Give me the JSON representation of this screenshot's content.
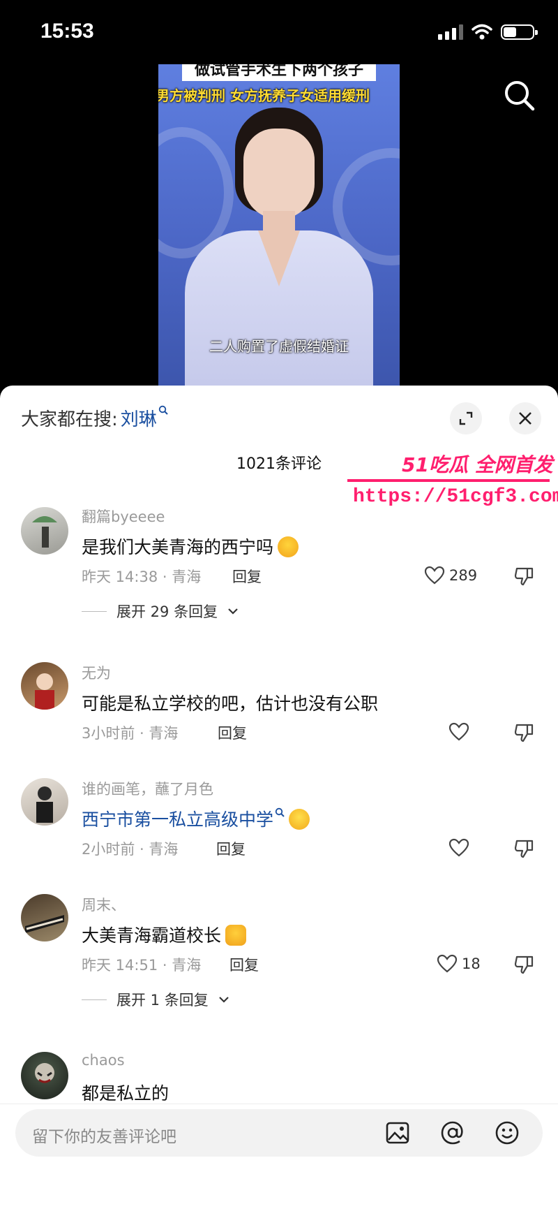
{
  "status_bar": {
    "time": "15:53"
  },
  "video": {
    "banner_top": "做试管手术生下两个孩子",
    "banner_second": "男方被判刑 女方抚养子女适用缓刑",
    "subtitle": "二人购置了虚假结婚证"
  },
  "panel": {
    "trending_label": "大家都在搜:",
    "trending_keyword": "刘琳",
    "comment_count": "1021条评论"
  },
  "watermark": {
    "brand": "51吃瓜 全网首发",
    "url": "https://51cgf3.com"
  },
  "comments": [
    {
      "name": "翻篇byeeee",
      "text": "是我们大美青海的西宁吗",
      "emoji": "laughing-with-tears",
      "meta": "昨天 14:38 · 青海",
      "reply": "回复",
      "likes": "289",
      "expand": "展开 29 条回复"
    },
    {
      "name": "无为",
      "text": "可能是私立学校的吧，估计也没有公职",
      "meta": "3小时前 · 青海",
      "reply": "回复",
      "likes": ""
    },
    {
      "name": "谁的画笔，蘸了月色",
      "text": "西宁市第一私立高级中学",
      "emoji": "grinning",
      "meta": "2小时前 · 青海",
      "reply": "回复",
      "likes": ""
    },
    {
      "name": "周末、",
      "text": "大美青海霸道校长",
      "emoji": "thumbs-up",
      "meta": "昨天 14:51 · 青海",
      "reply": "回复",
      "likes": "18",
      "expand": "展开 1 条回复"
    },
    {
      "name": "chaos",
      "text": "都是私立的"
    }
  ],
  "input": {
    "placeholder": "留下你的友善评论吧"
  },
  "icons": {
    "search": "search-icon",
    "expand": "expand-icon",
    "close": "close-icon",
    "heart": "heart-icon",
    "dislike": "thumb-down-icon",
    "image": "image-icon",
    "at": "at-icon",
    "emoji": "emoji-icon"
  },
  "colors": {
    "link": "#1a4fa0",
    "watermark": "#ff1f6e",
    "meta": "#9a9a9a"
  }
}
